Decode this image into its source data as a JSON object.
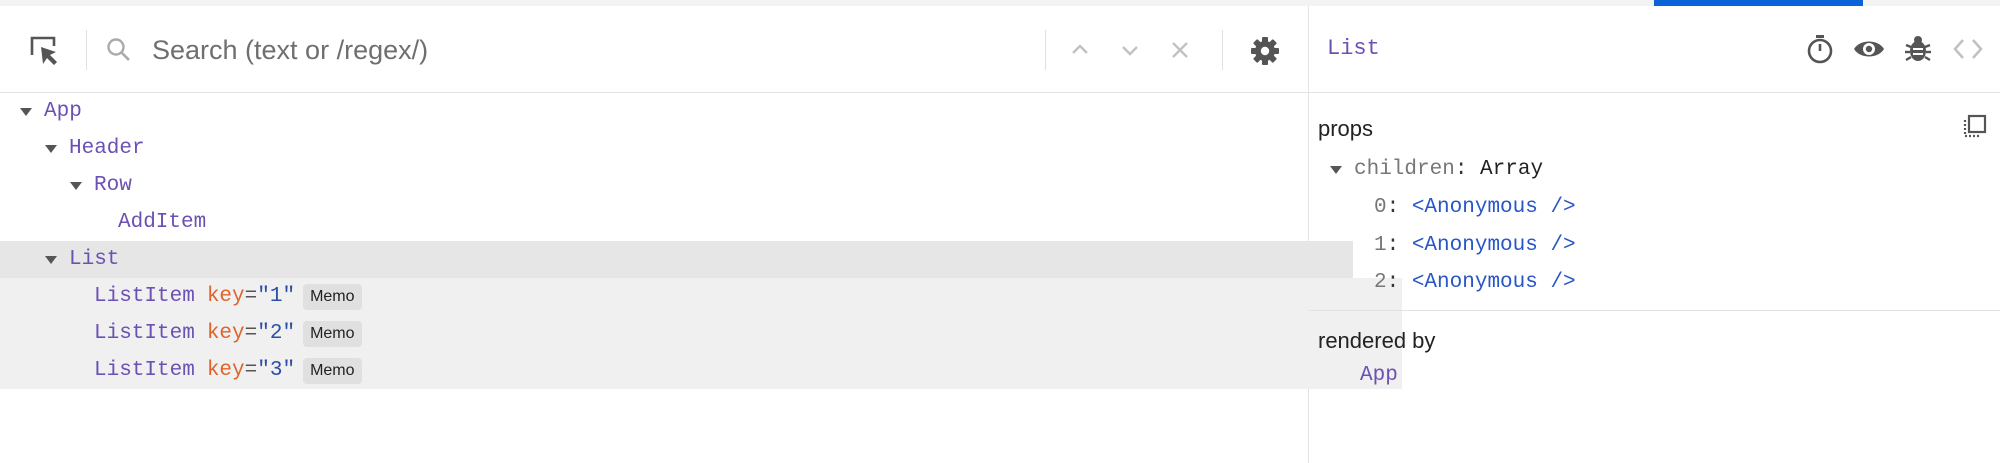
{
  "search": {
    "placeholder": "Search (text or /regex/)"
  },
  "tree": {
    "items": [
      {
        "label": "App",
        "expanded": true
      },
      {
        "label": "Header",
        "expanded": true
      },
      {
        "label": "Row",
        "expanded": true
      },
      {
        "label": "AddItem"
      },
      {
        "label": "List",
        "expanded": true,
        "selected": true
      },
      {
        "label": "ListItem",
        "key_label": "key",
        "key_value": "\"1\"",
        "badge": "Memo"
      },
      {
        "label": "ListItem",
        "key_label": "key",
        "key_value": "\"2\"",
        "badge": "Memo"
      },
      {
        "label": "ListItem",
        "key_label": "key",
        "key_value": "\"3\"",
        "badge": "Memo"
      }
    ]
  },
  "inspector": {
    "title": "List",
    "props_label": "props",
    "children_key": "children",
    "children_type": "Array",
    "children": [
      {
        "index": "0",
        "value": "<Anonymous />"
      },
      {
        "index": "1",
        "value": "<Anonymous />"
      },
      {
        "index": "2",
        "value": "<Anonymous />"
      }
    ],
    "rendered_by_label": "rendered by",
    "rendered_by": "App"
  },
  "icons": {
    "select": "select-element-icon",
    "search": "search-icon",
    "prev": "chevron-up-icon",
    "next": "chevron-down-icon",
    "clear": "close-icon",
    "settings": "gear-icon",
    "timer": "stopwatch-icon",
    "view": "eye-icon",
    "debug": "bug-icon",
    "source": "code-icon",
    "copy": "copy-icon"
  },
  "colors": {
    "accent": "#0b63d9",
    "component": "#6c51b3",
    "key": "#e0632d",
    "value": "#2856c6",
    "selected_row": "#e6e6e6"
  }
}
